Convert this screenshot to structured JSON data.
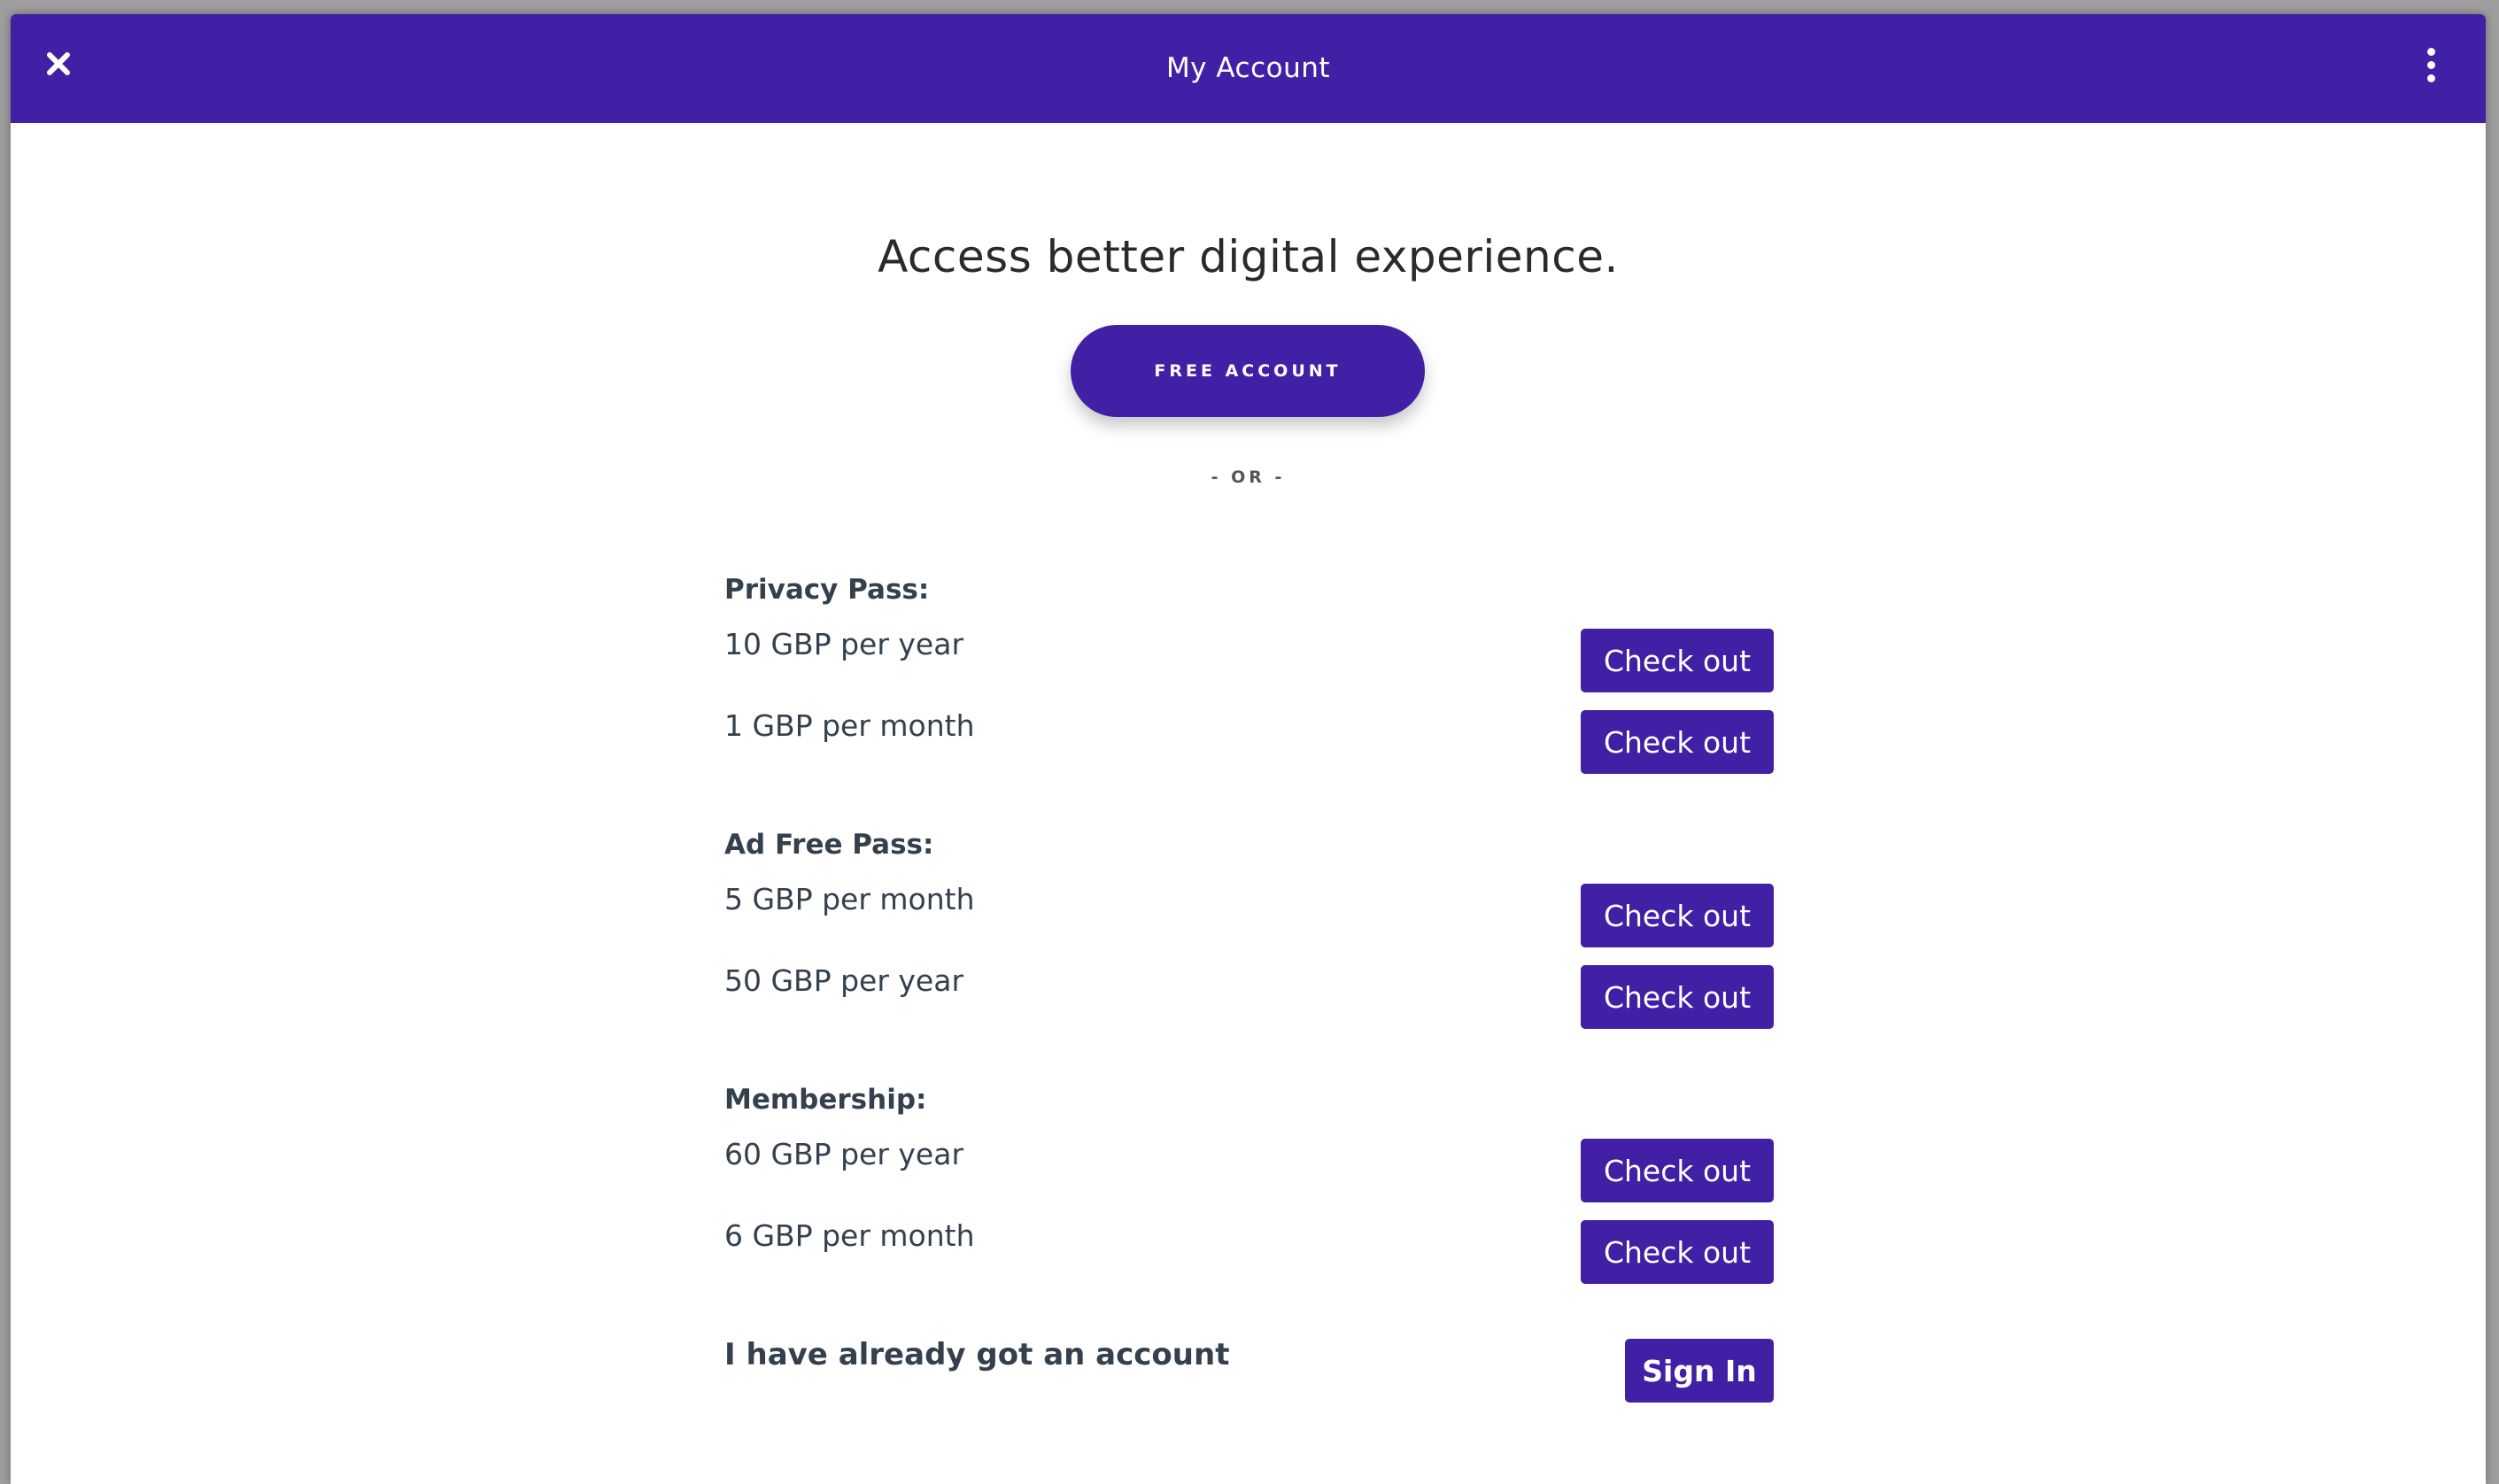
{
  "header": {
    "title": "My Account",
    "close_icon": "close-icon",
    "more_icon": "more-vertical-icon"
  },
  "hero": {
    "headline": "Access better digital experience.",
    "free_account_label": "FREE ACCOUNT",
    "or_text": "- OR -"
  },
  "plans": [
    {
      "title": "Privacy Pass:",
      "options": [
        {
          "price": "10 GBP per year",
          "button": "Check out"
        },
        {
          "price": "1 GBP per month",
          "button": "Check out"
        }
      ]
    },
    {
      "title": "Ad Free Pass:",
      "options": [
        {
          "price": "5 GBP per month",
          "button": "Check out"
        },
        {
          "price": "50 GBP per year",
          "button": "Check out"
        }
      ]
    },
    {
      "title": "Membership:",
      "options": [
        {
          "price": "60 GBP per year",
          "button": "Check out"
        },
        {
          "price": "6 GBP per month",
          "button": "Check out"
        }
      ]
    }
  ],
  "signin": {
    "text": "I have already got an account",
    "button": "Sign In"
  },
  "colors": {
    "brand": "#4220a5",
    "text": "#34404e",
    "background": "#ffffff"
  }
}
